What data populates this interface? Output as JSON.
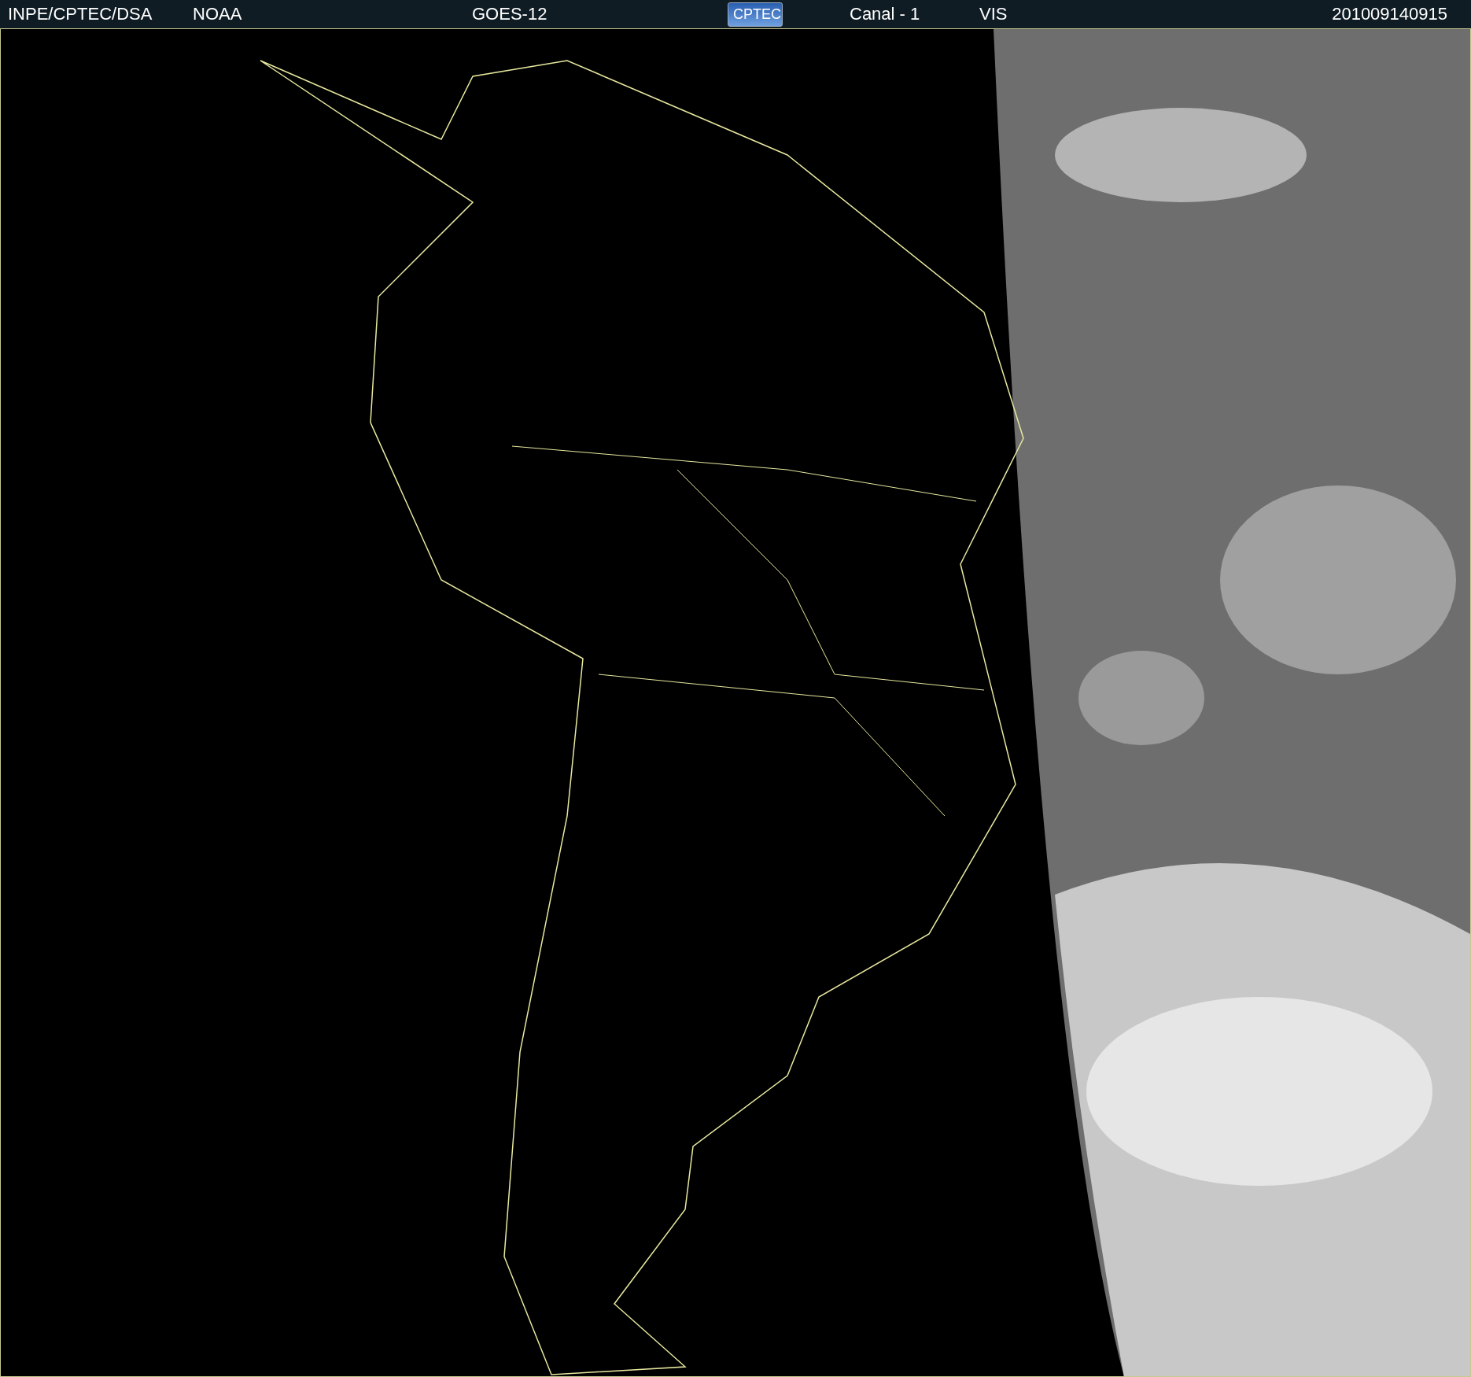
{
  "header": {
    "source": "INPE/CPTEC/DSA",
    "agency": "NOAA",
    "satellite": "GOES-12",
    "logo": "CPTEC",
    "channel": "Canal - 1",
    "band": "VIS",
    "timestamp": "201009140915"
  }
}
